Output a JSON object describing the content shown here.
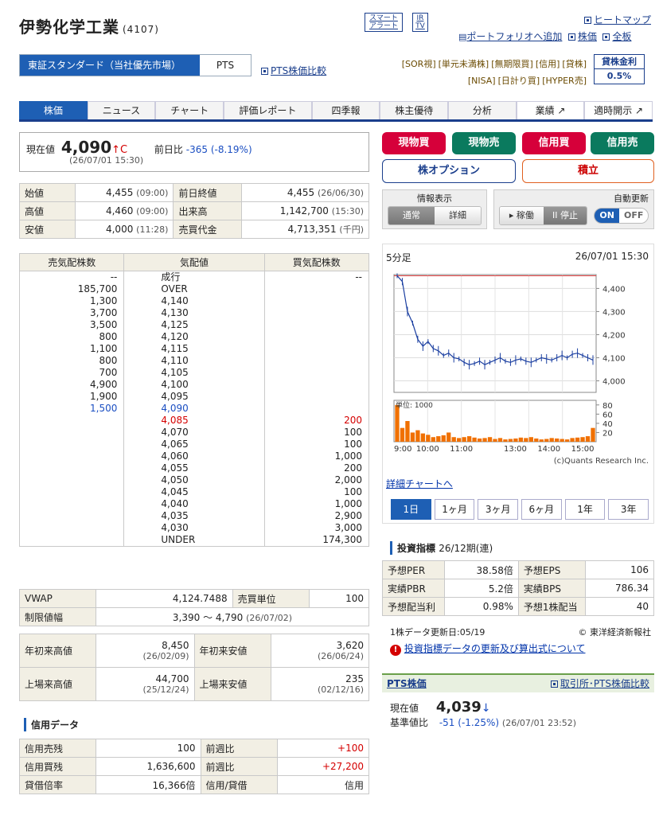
{
  "header": {
    "name": "伊勢化学工業",
    "code": "(4107)",
    "smart_alert": "スマート\nアラート",
    "ir_tv": "IR\nTV",
    "portfolio": "ポートフォリオへ追加",
    "heatmap": "ヒートマップ",
    "stock_price": "株価",
    "all_boards": "全板"
  },
  "market": {
    "primary": "東証スタンダード（当社優先市場）",
    "pts": "PTS",
    "pts_compare": "PTS株価比較",
    "tags": [
      "[SOR視]",
      "[単元未満株]",
      "[無期限買]",
      "[信用]",
      "[貸株]",
      "[NISA]",
      "[日計り買]",
      "[HYPER売]"
    ],
    "lending_label": "貸株金利",
    "lending_rate": "0.5%"
  },
  "tabs": [
    "株価",
    "ニュース",
    "チャート",
    "評価レポート",
    "四季報",
    "株主優待",
    "分析",
    "業績 ↗",
    "適時開示 ↗"
  ],
  "price": {
    "label": "現在値",
    "value": "4,090",
    "arrow": "↑C",
    "change_label": "前日比",
    "change": "-365 (-8.19%)",
    "time": "(26/07/01 15:30)"
  },
  "ohlc": [
    {
      "l1": "始値",
      "v1": "4,455",
      "t1": "(09:00)",
      "l2": "前日終値",
      "v2": "4,455",
      "t2": "(26/06/30)"
    },
    {
      "l1": "高値",
      "v1": "4,460",
      "t1": "(09:00)",
      "l2": "出来高",
      "v2": "1,142,700",
      "t2": "(15:30)"
    },
    {
      "l1": "安値",
      "v1": "4,000",
      "t1": "(11:28)",
      "l2": "売買代金",
      "v2": "4,713,351",
      "t2": "(千円)"
    }
  ],
  "board": {
    "head": [
      "売気配株数",
      "気配値",
      "買気配株数"
    ],
    "rows": [
      [
        "--",
        "成行",
        "--"
      ],
      [
        "185,700",
        "OVER",
        ""
      ],
      [
        "1,300",
        "4,140",
        ""
      ],
      [
        "3,700",
        "4,130",
        ""
      ],
      [
        "3,500",
        "4,125",
        ""
      ],
      [
        "800",
        "4,120",
        ""
      ],
      [
        "1,100",
        "4,115",
        ""
      ],
      [
        "800",
        "4,110",
        ""
      ],
      [
        "700",
        "4,105",
        ""
      ],
      [
        "4,900",
        "4,100",
        ""
      ],
      [
        "1,900",
        "4,095",
        ""
      ],
      [
        "1,500",
        "4,090",
        ""
      ],
      [
        "",
        "4,085",
        "200"
      ],
      [
        "",
        "4,070",
        "100"
      ],
      [
        "",
        "4,065",
        "100"
      ],
      [
        "",
        "4,060",
        "1,000"
      ],
      [
        "",
        "4,055",
        "200"
      ],
      [
        "",
        "4,050",
        "2,000"
      ],
      [
        "",
        "4,045",
        "100"
      ],
      [
        "",
        "4,040",
        "1,000"
      ],
      [
        "",
        "4,035",
        "2,900"
      ],
      [
        "",
        "4,030",
        "3,000"
      ],
      [
        "",
        "UNDER",
        "174,300"
      ]
    ]
  },
  "vwap": {
    "l1": "VWAP",
    "v1": "4,124.7488",
    "l2": "売買単位",
    "v2": "100",
    "limit_label": "制限値幅",
    "limit": "3,390 ～ 4,790",
    "limit_date": "(26/07/02)"
  },
  "yearly": [
    {
      "l1": "年初来高値",
      "v1": "8,450",
      "d1": "(26/02/09)",
      "l2": "年初来安値",
      "v2": "3,620",
      "d2": "(26/06/24)"
    },
    {
      "l1": "上場来高値",
      "v1": "44,700",
      "d1": "(25/12/24)",
      "l2": "上場来安値",
      "v2": "235",
      "d2": "(02/12/16)"
    }
  ],
  "credit": {
    "title": "信用データ",
    "rows": [
      {
        "l1": "信用売残",
        "v1": "100",
        "l2": "前週比",
        "v2": "+100"
      },
      {
        "l1": "信用買残",
        "v1": "1,636,600",
        "l2": "前週比",
        "v2": "+27,200"
      },
      {
        "l1": "貸借倍率",
        "v1": "16,366倍",
        "l2": "信用/貸借",
        "v2": "信用"
      }
    ]
  },
  "buttons": {
    "cash_buy": "現物買",
    "cash_sell": "現物売",
    "margin_buy": "信用買",
    "margin_sell": "信用売",
    "option": "株オプション",
    "accumulate": "積立"
  },
  "display": {
    "info_label": "情報表示",
    "normal": "通常",
    "detail": "詳細",
    "auto_label": "自動更新",
    "run": "▸ 稼働",
    "stop": "II 停止",
    "on": "ON",
    "off": "OFF"
  },
  "chart": {
    "period": "5分足",
    "time": "26/07/01 15:30",
    "price_ticks": [
      "4,400",
      "4,300",
      "4,200",
      "4,100",
      "4,000"
    ],
    "vol_unit": "単位: 1000",
    "vol_ticks": [
      "80",
      "60",
      "40",
      "20"
    ],
    "x_ticks": [
      "9:00",
      "10:00",
      "11:00",
      "13:00",
      "14:00",
      "15:00"
    ],
    "credit_text": "(c)Quants Research Inc.",
    "detail_link": "詳細チャートへ",
    "periods": [
      "1日",
      "1ヶ月",
      "3ヶ月",
      "6ヶ月",
      "1年",
      "3年"
    ]
  },
  "chart_data": {
    "type": "line",
    "title": "5分足",
    "price_series": [
      4455,
      4430,
      4300,
      4250,
      4180,
      4150,
      4170,
      4140,
      4130,
      4110,
      4120,
      4100,
      4095,
      4080,
      4070,
      4075,
      4085,
      4070,
      4080,
      4090,
      4100,
      4085,
      4080,
      4090,
      4095,
      4085,
      4080,
      4090,
      4100,
      4095,
      4090,
      4100,
      4110,
      4100,
      4115,
      4120,
      4110,
      4100,
      4090
    ],
    "previous_close": 4455,
    "ylim": [
      3950,
      4460
    ],
    "volume_unit": "1000",
    "volume_series": [
      80,
      30,
      45,
      20,
      25,
      18,
      15,
      10,
      12,
      14,
      20,
      10,
      8,
      10,
      12,
      9,
      7,
      8,
      10,
      6,
      8,
      5,
      6,
      7,
      9,
      8,
      10,
      7,
      5,
      6,
      8,
      7,
      6,
      5,
      8,
      9,
      10,
      12,
      30
    ],
    "x_labels": [
      "9:00",
      "10:00",
      "11:00",
      "13:00",
      "14:00",
      "15:00"
    ]
  },
  "indicators": {
    "title": "投資指標",
    "period": "26/12期(連)",
    "rows": [
      {
        "l1": "予想PER",
        "v1": "38.58倍",
        "l2": "予想EPS",
        "v2": "106"
      },
      {
        "l1": "実績PBR",
        "v1": "5.2倍",
        "l2": "実績BPS",
        "v2": "786.34"
      },
      {
        "l1": "予想配当利",
        "v1": "0.98%",
        "l2": "予想1株配当",
        "v2": "40"
      }
    ],
    "updated": "1株データ更新日:05/19",
    "source": "© 東洋経済新報社",
    "note_link": "投資指標データの更新及び算出式について"
  },
  "pts": {
    "title": "PTS株価",
    "compare_link": "取引所･PTS株価比較",
    "label": "現在値",
    "value": "4,039",
    "arrow": "↓",
    "base_label": "基準値比",
    "change": "-51 (-1.25%)",
    "time": "(26/07/01 23:52)"
  }
}
